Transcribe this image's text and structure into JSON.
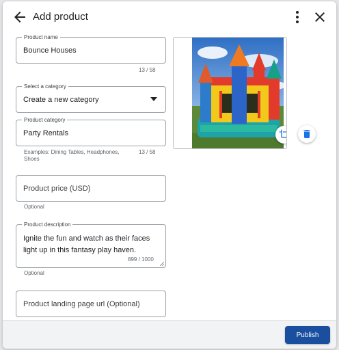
{
  "header": {
    "title": "Add product",
    "back_icon": "arrow-back-icon",
    "more_icon": "more-vert-icon",
    "close_icon": "close-icon"
  },
  "form": {
    "product_name": {
      "label": "Product name",
      "value": "Bounce Houses",
      "counter": "13 / 58"
    },
    "category_select": {
      "label": "Select a category",
      "value": "Create a new category"
    },
    "product_category": {
      "label": "Product category",
      "value": "Party Rentals",
      "hint": "Examples: Dining Tables, Headphones, Shoes",
      "counter": "13 / 58"
    },
    "product_price": {
      "placeholder": "Product price (USD)",
      "hint": "Optional"
    },
    "product_description": {
      "label": "Product description",
      "value": "Ignite the fun and watch as their faces light up in this fantasy play haven.",
      "counter": "899 / 1000",
      "hint": "Optional"
    },
    "landing_page": {
      "placeholder": "Product landing page url (Optional)"
    }
  },
  "image": {
    "subject": "inflatable castle bounce house",
    "crop_icon": "crop-icon",
    "delete_icon": "delete-icon"
  },
  "footer": {
    "publish_label": "Publish"
  },
  "colors": {
    "primary": "#1a4fa0",
    "border": "#9aa0a6",
    "delete_icon": "#1a73e8"
  }
}
